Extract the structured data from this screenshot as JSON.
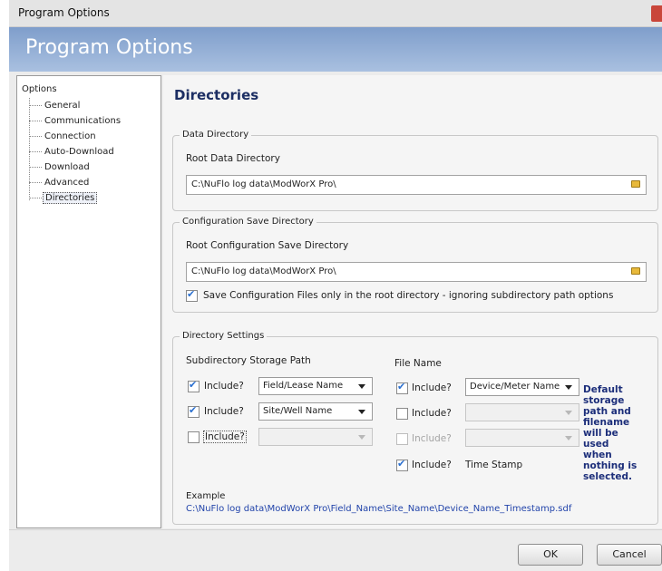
{
  "window": {
    "title": "Program Options"
  },
  "banner": {
    "title": "Program Options"
  },
  "tree": {
    "root": "Options",
    "items": [
      "General",
      "Communications",
      "Connection",
      "Auto-Download",
      "Download",
      "Advanced",
      "Directories"
    ],
    "selected": "Directories"
  },
  "page": {
    "heading": "Directories"
  },
  "data_directory": {
    "legend": "Data Directory",
    "label": "Root Data Directory",
    "value": "C:\\NuFlo log data\\ModWorX Pro\\"
  },
  "config_directory": {
    "legend": "Configuration Save Directory",
    "label": "Root Configuration Save Directory",
    "value": "C:\\NuFlo log data\\ModWorX Pro\\",
    "checkbox_label": "Save Configuration Files only in the root directory - ignoring subdirectory path options",
    "checked": true
  },
  "directory_settings": {
    "legend": "Directory Settings",
    "subdir_heading": "Subdirectory Storage Path",
    "filename_heading": "File Name",
    "subdir_rows": [
      {
        "label": "Include?",
        "checked": true,
        "value": "Field/Lease Name",
        "enabled": true
      },
      {
        "label": "Include?",
        "checked": true,
        "value": "Site/Well Name",
        "enabled": true
      },
      {
        "label": "Include?",
        "checked": false,
        "value": "",
        "enabled": true
      }
    ],
    "file_rows": [
      {
        "label": "Include?",
        "checked": true,
        "value": "Device/Meter Name",
        "enabled": true
      },
      {
        "label": "Include?",
        "checked": false,
        "value": "",
        "enabled": true
      },
      {
        "label": "Include?",
        "checked": false,
        "value": "",
        "enabled": false
      },
      {
        "label": "Include?",
        "checked": true,
        "value": "Time Stamp",
        "enabled": true
      }
    ],
    "note": "Default storage path and filename will be used when nothing is selected.",
    "example_label": "Example",
    "example_value": "C:\\NuFlo log data\\ModWorX Pro\\Field_Name\\Site_Name\\Device_Name_Timestamp.sdf"
  },
  "buttons": {
    "ok": "OK",
    "cancel": "Cancel"
  },
  "colors": {
    "banner": "#8fa9d3",
    "heading": "#1c2e63",
    "note": "#1c2e7a",
    "link": "#2244aa",
    "check": "#2a6fd0"
  },
  "icons": {
    "folder": "folder-icon",
    "check": "checkmark-icon",
    "dropdown": "chevron-down-icon",
    "close": "close-icon"
  }
}
